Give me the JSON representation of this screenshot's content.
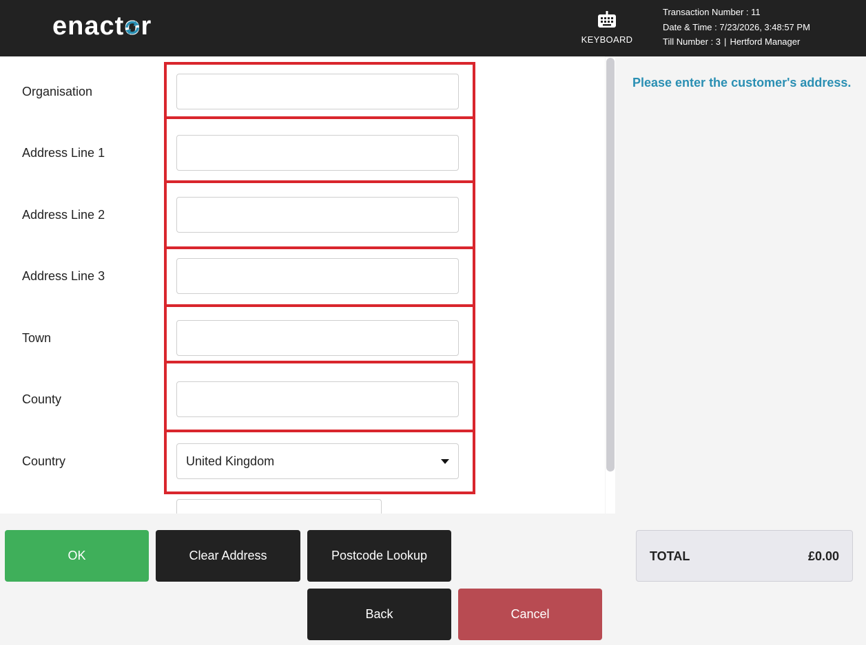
{
  "header": {
    "logo_prefix": "enact",
    "logo_o": "o",
    "logo_suffix": "r",
    "keyboard_label": "KEYBOARD",
    "transaction_number": "Transaction Number : 11",
    "date_time": "Date & Time : 7/23/2026, 3:48:57 PM",
    "till_number": "Till Number : 3",
    "separator": "|",
    "user": "Hertford Manager"
  },
  "form": {
    "fields": [
      {
        "label": "Organisation",
        "value": "",
        "placeholder": ""
      },
      {
        "label": "Address Line 1",
        "value": "",
        "placeholder": ""
      },
      {
        "label": "Address Line 2",
        "value": "",
        "placeholder": ""
      },
      {
        "label": "Address Line 3",
        "value": "",
        "placeholder": ""
      },
      {
        "label": "Town",
        "value": "",
        "placeholder": ""
      },
      {
        "label": "County",
        "value": "",
        "placeholder": ""
      }
    ],
    "country": {
      "label": "Country",
      "selected": "United Kingdom"
    }
  },
  "prompt": "Please enter the customer's address.",
  "buttons": {
    "ok": "OK",
    "clear_address": "Clear Address",
    "postcode_lookup": "Postcode Lookup",
    "back": "Back",
    "cancel": "Cancel"
  },
  "total": {
    "label": "TOTAL",
    "value": "£0.00"
  },
  "colors": {
    "header_bg": "#222222",
    "highlight_red": "#d9262d",
    "prompt_blue": "#2a8fb3",
    "ok_green": "#3faf5a",
    "cancel_red": "#b84b52",
    "logo_accent": "#2a8fb3"
  },
  "icons": {
    "keyboard": "keyboard-icon",
    "dropdown": "caret-down-icon",
    "logo_arrows": "refresh-arrows-icon"
  }
}
